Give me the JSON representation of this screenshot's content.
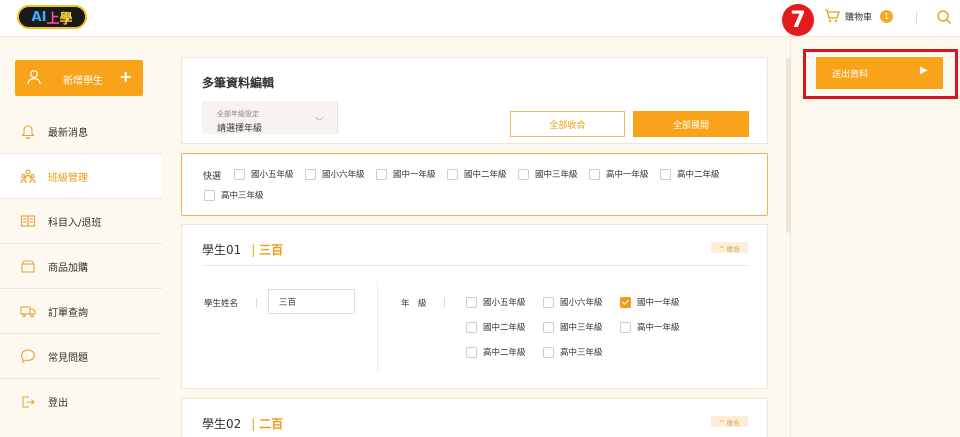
{
  "header": {
    "logo": {
      "ai": "AI",
      "shang": "上",
      "xue": "學"
    },
    "step_number": "7",
    "cart_label": "購物車",
    "cart_count": "1"
  },
  "sidebar": {
    "add_student_label": "新增學生",
    "add_plus": "+",
    "items": [
      {
        "label": "最新消息",
        "icon": "bell-icon"
      },
      {
        "label": "班級管理",
        "icon": "class-management-icon"
      },
      {
        "label": "科目入/退班",
        "icon": "book-icon"
      },
      {
        "label": "商品加購",
        "icon": "shop-icon"
      },
      {
        "label": "訂單查詢",
        "icon": "truck-icon"
      },
      {
        "label": "常見問題",
        "icon": "chat-bubble-icon"
      },
      {
        "label": "登出",
        "icon": "logout-icon"
      }
    ]
  },
  "main": {
    "title": "多筆資料編輯",
    "grade_setting": {
      "small_label": "全部年級設定",
      "value": "請選擇年級"
    },
    "collapse_all_label": "全部收合",
    "expand_all_label": "全部展開",
    "quick": {
      "label": "快選",
      "options": [
        "國小五年級",
        "國小六年級",
        "國中一年級",
        "國中二年級",
        "國中三年級",
        "高中一年級",
        "高中二年級",
        "高中三年級"
      ]
    },
    "students": [
      {
        "id_label": "學生01",
        "sep": "|",
        "name": "三百",
        "collapse_label": "^ 收合",
        "field_label": "學生姓名",
        "name_value": "三百",
        "grade_label": "年　級",
        "grades": [
          {
            "label": "國小五年級",
            "checked": false
          },
          {
            "label": "國小六年級",
            "checked": false
          },
          {
            "label": "國中一年級",
            "checked": true
          },
          {
            "label": "國中二年級",
            "checked": false
          },
          {
            "label": "國中三年級",
            "checked": false
          },
          {
            "label": "高中一年級",
            "checked": false
          },
          {
            "label": "高中二年級",
            "checked": false
          },
          {
            "label": "高中三年級",
            "checked": false
          }
        ]
      },
      {
        "id_label": "學生02",
        "sep": "|",
        "name": "二百",
        "collapse_label": "^ 收合"
      }
    ]
  },
  "right": {
    "submit_label": "送出資料",
    "submit_arrow": "▶"
  },
  "colors": {
    "accent": "#f9a31a",
    "highlight": "#d8151b"
  }
}
